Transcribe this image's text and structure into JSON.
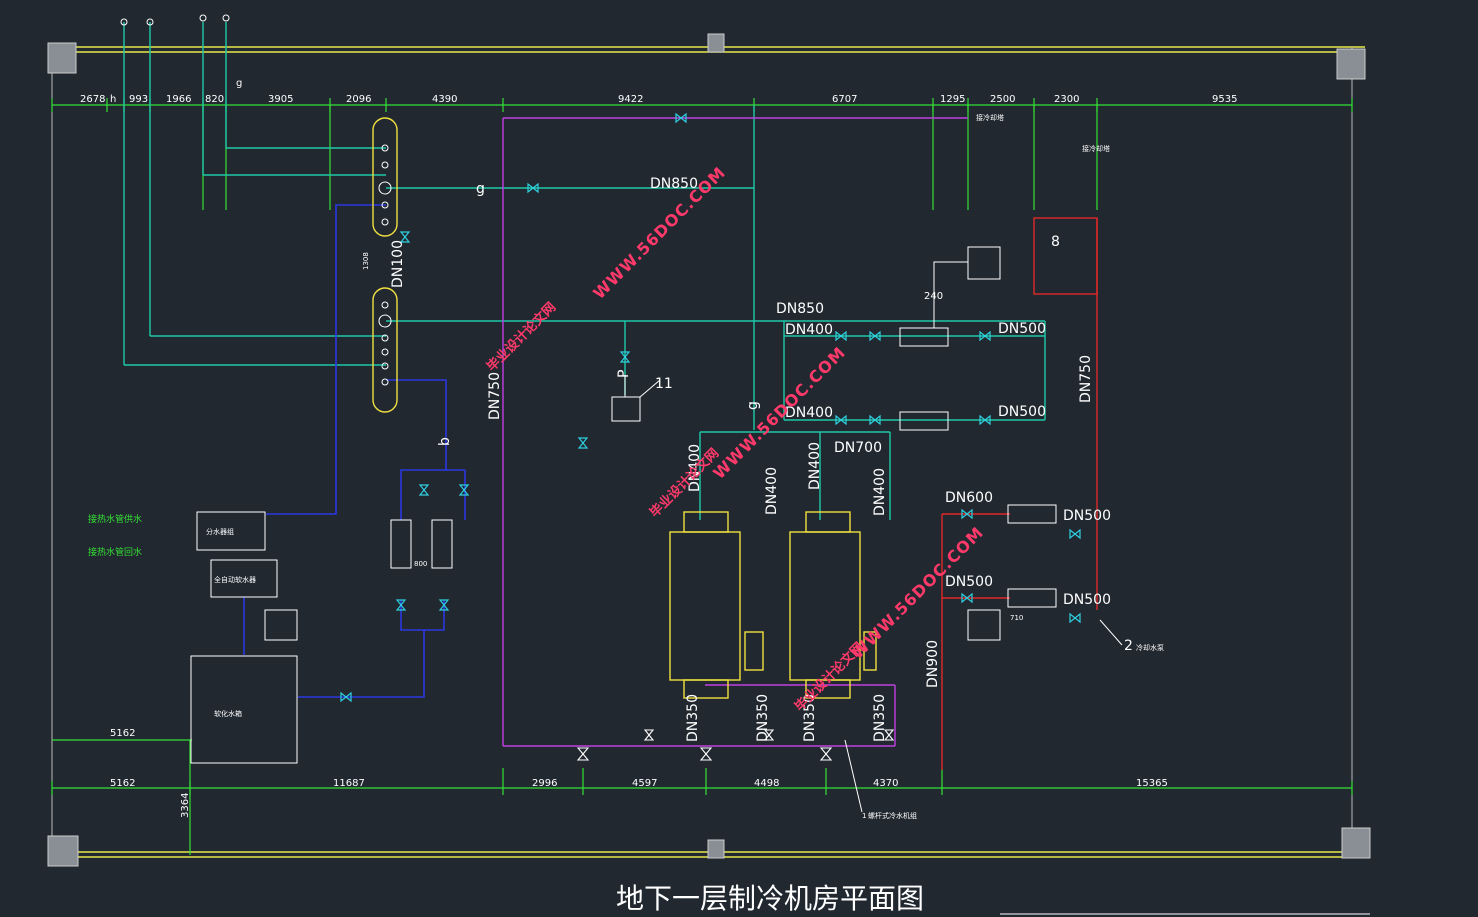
{
  "title": "地下一层制冷机房平面图",
  "dimensions": {
    "top": [
      "2678",
      "993",
      "1966",
      "820",
      "3905",
      "2096",
      "4390",
      "9422",
      "6707",
      "1295",
      "2500",
      "2300",
      "9535"
    ],
    "bottom": [
      "5162",
      "11687",
      "2996",
      "4597",
      "4498",
      "4370",
      "15365"
    ],
    "left_upper": "5162",
    "vertical": "3364"
  },
  "pipe_labels": {
    "dn850_top": "DN850",
    "dn850_mid": "DN850",
    "dn400_a": "DN400",
    "dn400_b": "DN400",
    "dn500_a": "DN500",
    "dn500_b": "DN500",
    "dn500_c": "DN500",
    "dn500_d": "DN500",
    "dn700": "DN700",
    "dn750_left": "DN750",
    "dn750_right": "DN750",
    "dn100": "DN100",
    "dn600": "DN600",
    "dn500_e": "DN500",
    "dn900": "DN900",
    "dn400_v1": "DN400",
    "dn400_v2": "DN400",
    "dn400_v3": "DN400",
    "dn400_v4": "DN400",
    "dn350_1": "DN350",
    "dn350_2": "DN350",
    "dn350_3": "DN350",
    "dn350_4": "DN350"
  },
  "markers": {
    "g1": "g",
    "g2": "g",
    "g3": "g",
    "b1": "b",
    "h1": "h",
    "p1": "P",
    "n11": "11",
    "n8": "8",
    "n2": "2",
    "n240": "240",
    "n1308": "1308",
    "n800": "800",
    "n710": "710",
    "n1": "1"
  },
  "legend_labels": {
    "supply": "接热水管供水",
    "return": "接热水管回水",
    "device_a": "分水器组",
    "device_b": "全自动软水器",
    "tank": "软化水箱",
    "cooling_tower_1": "接冷却塔",
    "cooling_tower_2": "接冷却塔",
    "pump_note": "冷却水泵",
    "chiller_note": "螺杆式冷水机组"
  },
  "watermark": {
    "url": "WWW.56DOC.COM",
    "cn": "毕业设计论文网"
  },
  "colors": {
    "background": "#212830",
    "wall": "#e8e84a",
    "dimension": "#35e035",
    "chilled": "#1fc8a8",
    "cyan": "#2fd0e0",
    "purple": "#c040e0",
    "red": "#e02828",
    "blue": "#2a38e0",
    "yellow": "#f0e040",
    "white": "#ffffff",
    "watermark": "#ff3a6a"
  }
}
